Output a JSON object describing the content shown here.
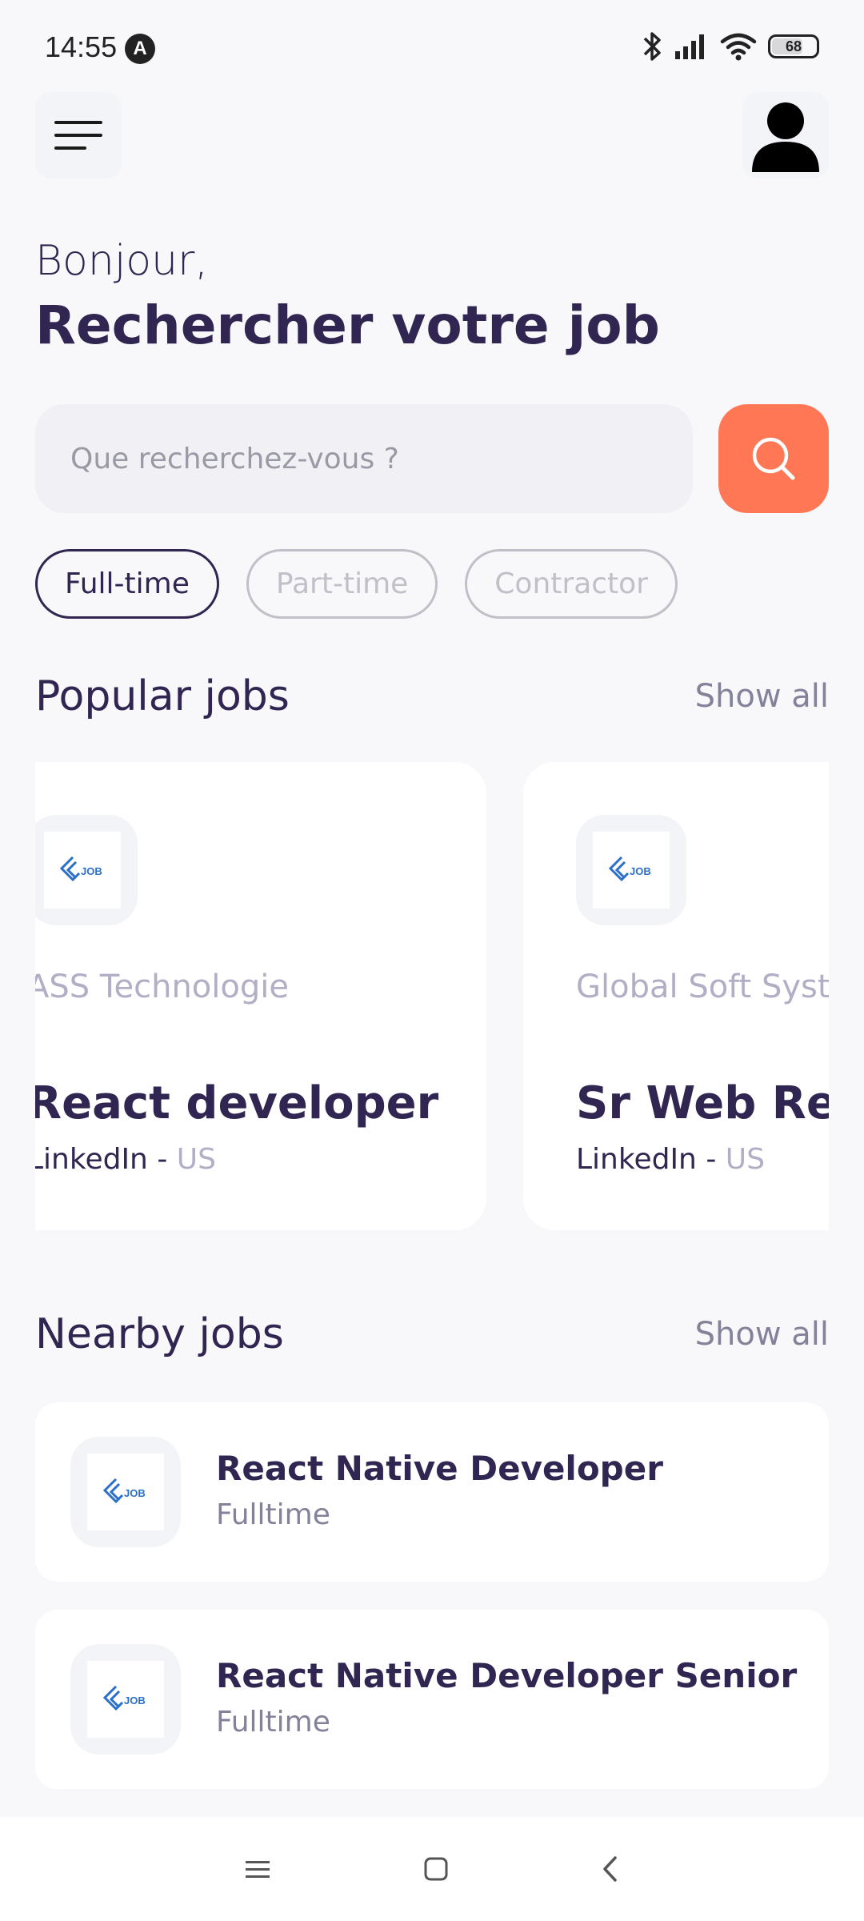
{
  "status_bar": {
    "time": "14:55",
    "notification_letter": "A",
    "battery": "68"
  },
  "header": {
    "menu_icon": "hamburger-menu-icon",
    "profile_icon": "user-avatar-icon"
  },
  "welcome": {
    "greeting": "Bonjour,",
    "headline": "Rechercher votre job"
  },
  "search": {
    "placeholder": "Que recherchez-vous ?",
    "button_icon": "search-icon"
  },
  "job_types": [
    {
      "label": "Full-time",
      "active": true
    },
    {
      "label": "Part-time",
      "active": false
    },
    {
      "label": "Contractor",
      "active": false
    }
  ],
  "popular": {
    "title": "Popular jobs",
    "show_all": "Show all",
    "cards": [
      {
        "company": "ASS Technologie",
        "title": "React developer",
        "publisher": "LinkedIn",
        "separator": " - ",
        "country": "US"
      },
      {
        "company": "Global Soft Systems",
        "title": "Sr Web React",
        "publisher": "LinkedIn",
        "separator": " - ",
        "country": "US"
      }
    ]
  },
  "nearby": {
    "title": "Nearby jobs",
    "show_all": "Show all",
    "items": [
      {
        "title": "React Native Developer",
        "type": "Fulltime"
      },
      {
        "title": "React Native Developer Senior",
        "type": "Fulltime"
      }
    ]
  },
  "colors": {
    "primary": "#312651",
    "accent": "#FF7754",
    "gray": "#83829A",
    "background": "#F8F8FB"
  }
}
